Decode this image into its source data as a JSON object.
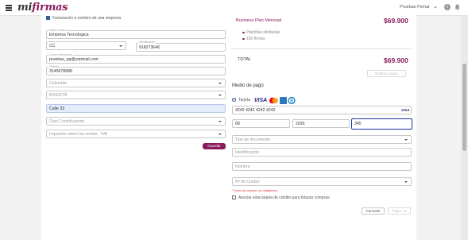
{
  "header": {
    "logo_prefix": "mi",
    "logo_main": "firmas",
    "user_name": "Pruebas Firmar",
    "chevron": "⌄",
    "info_symbol": "i"
  },
  "billing": {
    "checkbox_label": "Facturación a nombre de una empresa",
    "company_label": "Razón social",
    "company_value": "Empresa Tecnologica",
    "doctype_value": "CC",
    "doc_label": "Identificación",
    "doc_value": "918273646",
    "email_label": "Correo electrónico",
    "email_value": "pruebas_qa@yopmail.com",
    "phone_label": "Teléfono",
    "phone_value": "3145678888",
    "country_value": "Colombia",
    "city_value": "BOGOTÁ",
    "address_value": "Calle 33",
    "fiscal_placeholder": "Dian Contribuyente",
    "tax_placeholder": "Impuesto sobre las ventas - IVA",
    "save_label": "Guardar"
  },
  "summary": {
    "plan_name": "Business Plan Mensual",
    "plan_price": "$69.900",
    "features": [
      "Plantillas ilimitadas",
      "150 firmas"
    ],
    "total_label": "TOTAL",
    "total_value": "$69.900",
    "coupon_label": "Redimir cupón"
  },
  "payment": {
    "title": "Medio de pago",
    "method_label": "Tarjeta",
    "card_number": "4242 4242 4242 4242",
    "card_brand": "VISA",
    "exp_month": "08",
    "exp_year": "2026",
    "cvv": "345",
    "doctype_placeholder": "Tipo de documento",
    "id_placeholder": "Identificación",
    "name_placeholder": "Nombre",
    "installments_placeholder": "Nº de Cuotas",
    "required_note": "* Todos los campos son obligatorios",
    "save_card_label": "Asociar esta tarjeta de crédito para futuras compras",
    "cancel_label": "Cancelar",
    "pay_label": "Pagar Ya"
  },
  "colors": {
    "brand": "#8a1c5e",
    "focus": "#1a2fa8",
    "checkbox": "#3c5a9a"
  }
}
